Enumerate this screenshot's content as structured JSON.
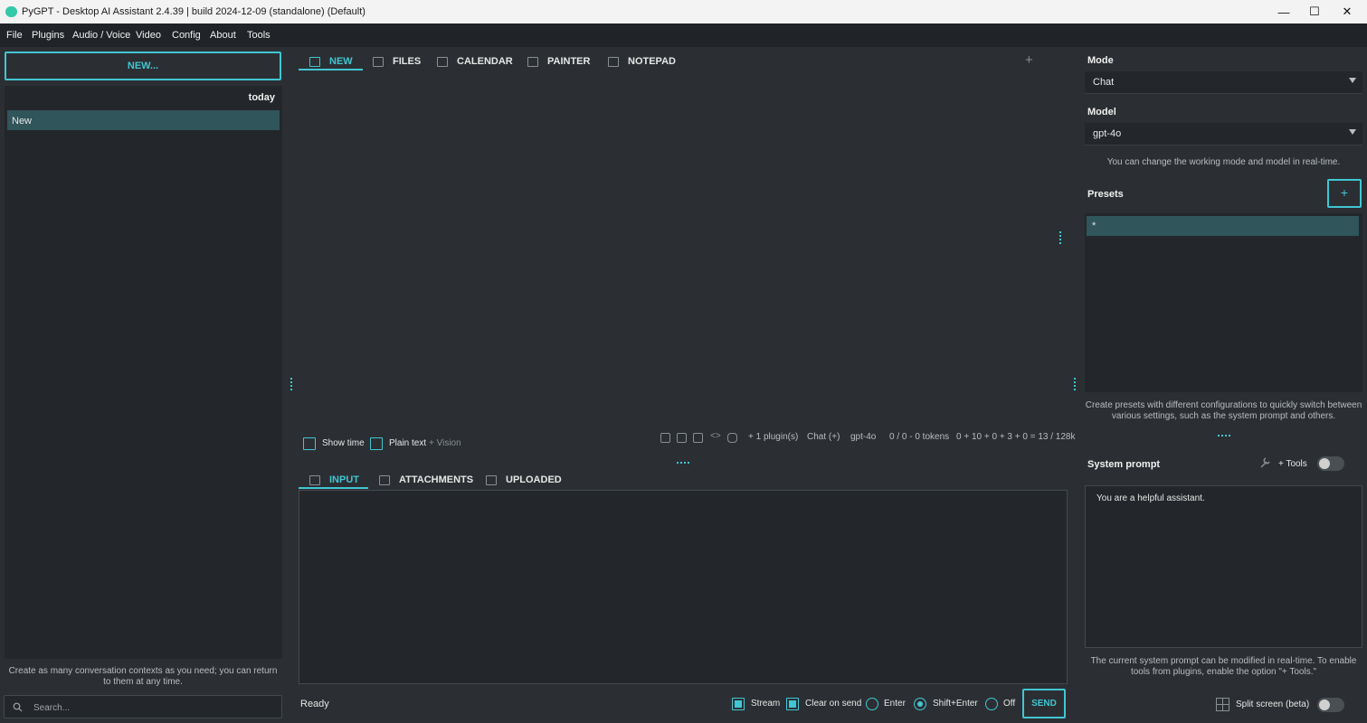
{
  "window": {
    "title": "PyGPT - Desktop AI Assistant 2.4.39 | build 2024-12-09 (standalone) (Default)"
  },
  "menu": [
    "File",
    "Plugins",
    "Audio / Voice",
    "Video",
    "Config",
    "About",
    "Tools"
  ],
  "left": {
    "new_button": "NEW...",
    "group_label": "today",
    "contexts": [
      "New"
    ],
    "hint": "Create as many conversation contexts as you need; you can return to them at any time.",
    "search_placeholder": "Search..."
  },
  "tabs": [
    "NEW",
    "FILES",
    "CALENDAR",
    "PAINTER",
    "NOTEPAD"
  ],
  "add_tab_symbol": "+",
  "output_options": {
    "show_time": "Show time",
    "plain_text": "Plain text",
    "vision": "+ Vision"
  },
  "status": {
    "plugins": "+ 1 plugin(s)",
    "mode": "Chat (+)",
    "model": "gpt-4o",
    "tokens": "0 / 0 - 0 tokens",
    "context": "0 + 10 + 0 + 3 + 0 = 13 / 128k"
  },
  "input_tabs": [
    "INPUT",
    "ATTACHMENTS",
    "UPLOADED"
  ],
  "footer": {
    "status": "Ready",
    "stream": "Stream",
    "clear_on_send": "Clear on send",
    "enter": "Enter",
    "shift_enter": "Shift+Enter",
    "off": "Off",
    "send": "SEND"
  },
  "right": {
    "mode_label": "Mode",
    "mode_value": "Chat",
    "model_label": "Model",
    "model_value": "gpt-4o",
    "mode_hint": "You can change the working mode and model in real-time.",
    "presets_label": "Presets",
    "preset_add": "+",
    "presets": [
      "*"
    ],
    "presets_hint": "Create presets with different configurations to quickly switch between various settings, such as the system prompt and others.",
    "system_prompt_label": "System prompt",
    "tools_label": "+ Tools",
    "system_prompt": "You are a helpful assistant.",
    "system_prompt_hint": "The current system prompt can be modified in real-time. To enable tools from plugins, enable the option \"+ Tools.\"",
    "split_screen": "Split screen (beta)"
  },
  "colors": {
    "accent": "#41c6d3",
    "background": "#2b2f33",
    "panel": "#23272b",
    "selected": "#30555a"
  }
}
